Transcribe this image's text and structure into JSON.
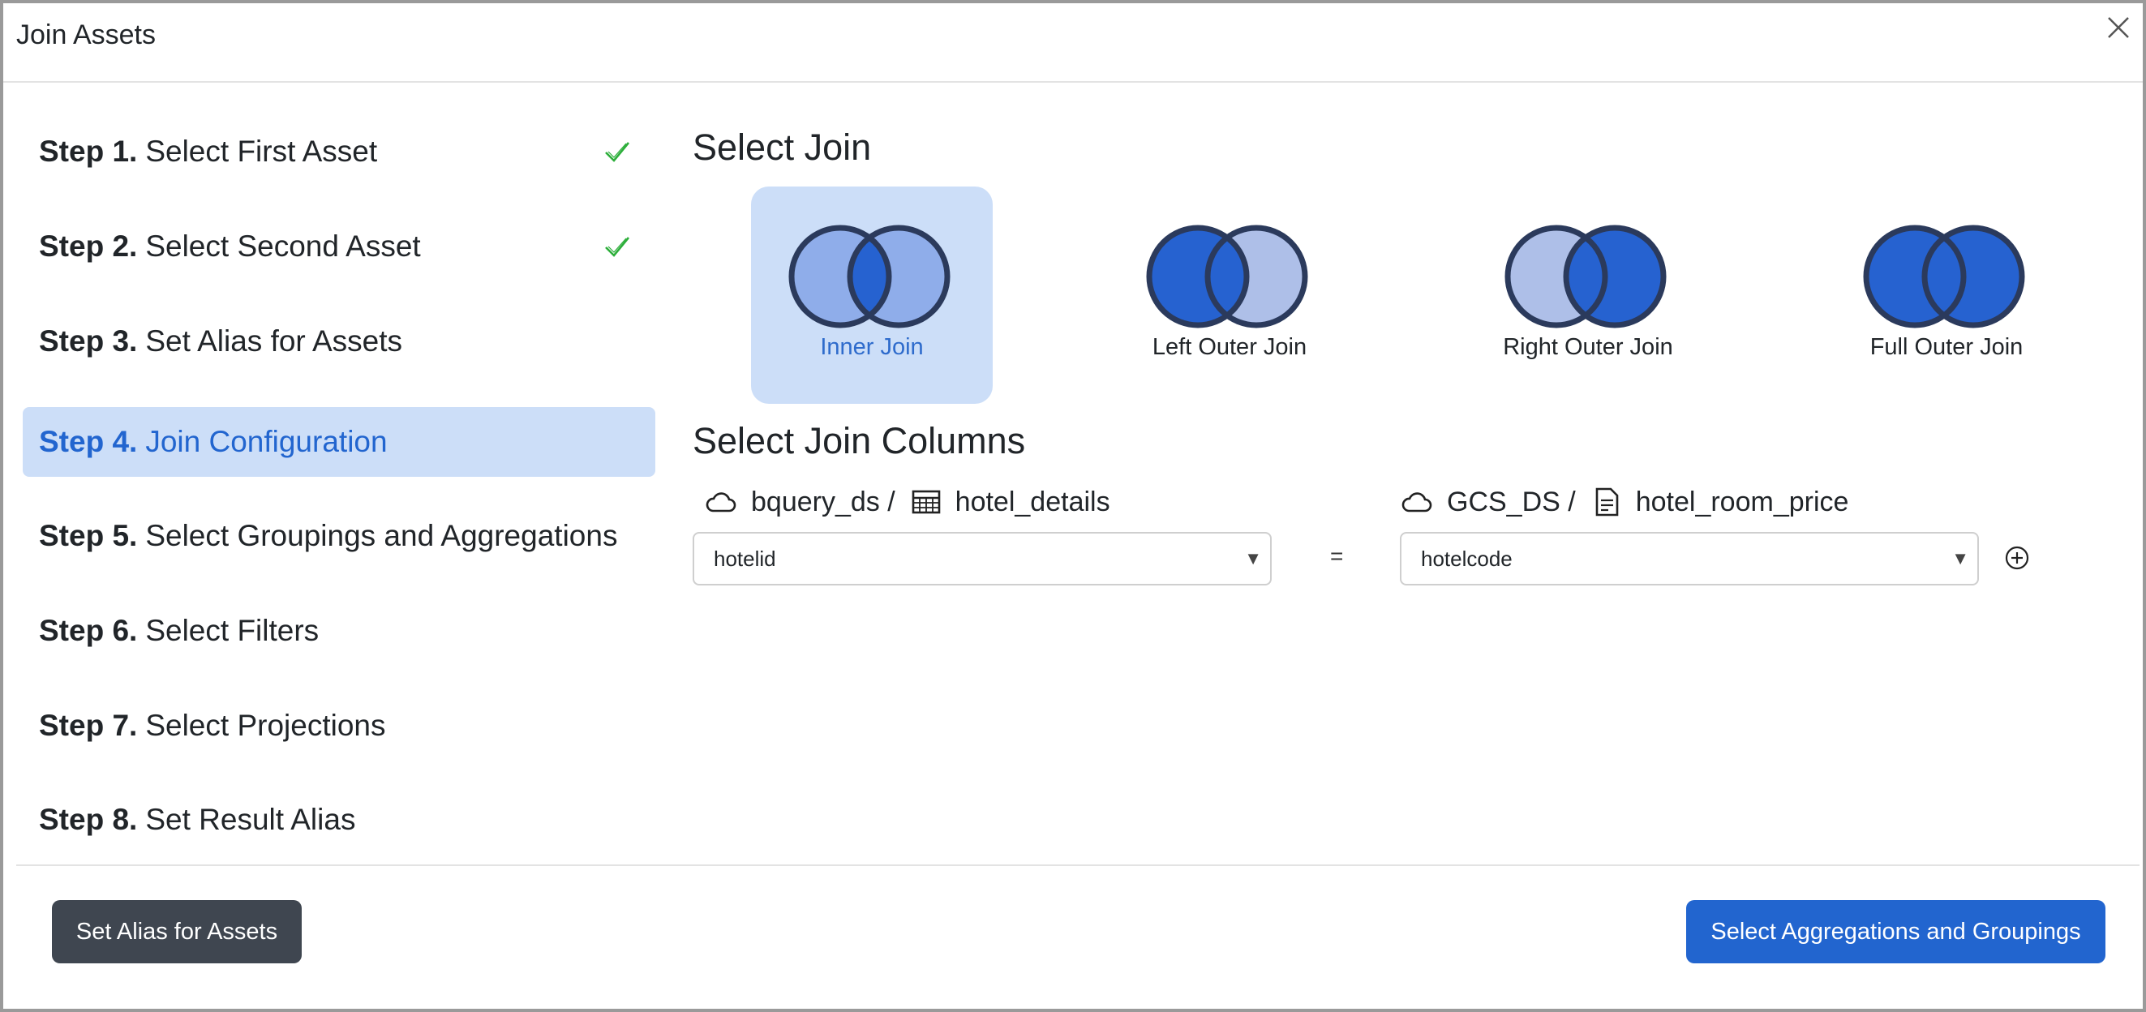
{
  "dialog": {
    "title": "Join Assets"
  },
  "steps": [
    {
      "num": "Step 1.",
      "label": "Select First Asset",
      "done": true
    },
    {
      "num": "Step 2.",
      "label": "Select Second Asset",
      "done": true
    },
    {
      "num": "Step 3.",
      "label": "Set Alias for Assets",
      "done": false
    },
    {
      "num": "Step 4.",
      "label": "Join Configuration",
      "done": false,
      "active": true
    },
    {
      "num": "Step 5.",
      "label": "Select Groupings and Aggregations",
      "done": false
    },
    {
      "num": "Step 6.",
      "label": "Select Filters",
      "done": false
    },
    {
      "num": "Step 7.",
      "label": "Select Projections",
      "done": false
    },
    {
      "num": "Step 8.",
      "label": "Set Result Alias",
      "done": false
    }
  ],
  "main": {
    "select_join_title": "Select Join",
    "join_types": [
      {
        "label": "Inner Join",
        "selected": true
      },
      {
        "label": "Left Outer Join",
        "selected": false
      },
      {
        "label": "Right Outer Join",
        "selected": false
      },
      {
        "label": "Full Outer Join",
        "selected": false
      }
    ],
    "columns_title": "Select Join Columns",
    "left": {
      "datasource": "bquery_ds /",
      "asset": "hotel_details",
      "column": "hotelid",
      "asset_icon": "table-icon"
    },
    "right": {
      "datasource": "GCS_DS /",
      "asset": "hotel_room_price",
      "column": "hotelcode",
      "asset_icon": "file-icon"
    },
    "equals": "="
  },
  "footer": {
    "back_label": "Set Alias for Assets",
    "next_label": "Select Aggregations and Groupings"
  },
  "colors": {
    "accent": "#2265cf",
    "selected_bg": "#ccdef8",
    "circle_dark": "#2662d0",
    "circle_light": "#aebfe8",
    "circle_inner_light": "#8fadea",
    "check": "#2cae3a"
  }
}
